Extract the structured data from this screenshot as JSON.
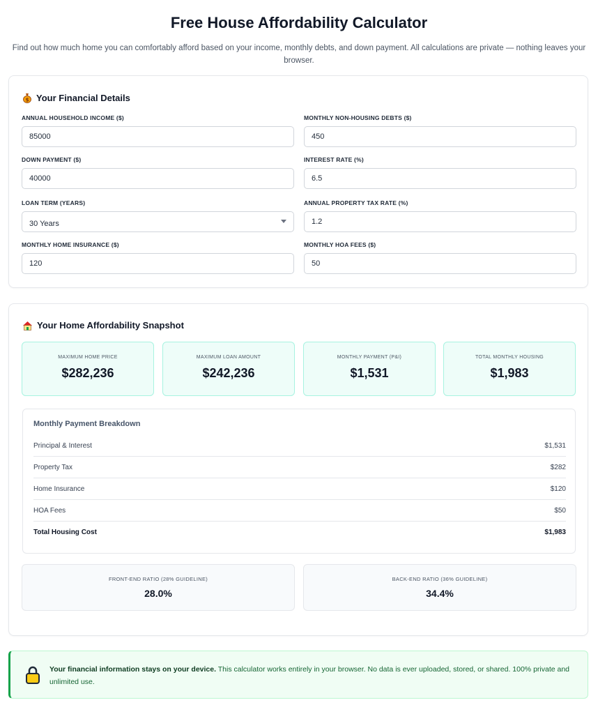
{
  "header": {
    "title": "Free House Affordability Calculator",
    "subtitle": "Find out how much home you can comfortably afford based on your income, monthly debts, and down payment. All calculations are private — nothing leaves your browser."
  },
  "details": {
    "title": "Your Financial Details",
    "icon": "money-bag-icon",
    "fields": {
      "income": {
        "label": "Annual Household Income ($)",
        "value": "85000"
      },
      "debts": {
        "label": "Monthly Non-Housing Debts ($)",
        "value": "450"
      },
      "down": {
        "label": "Down Payment ($)",
        "value": "40000"
      },
      "rate": {
        "label": "Interest Rate (%)",
        "value": "6.5"
      },
      "term": {
        "label": "Loan Term (Years)",
        "value": "30 Years"
      },
      "tax": {
        "label": "Annual Property Tax Rate (%)",
        "value": "1.2"
      },
      "insurance": {
        "label": "Monthly Home Insurance ($)",
        "value": "120"
      },
      "hoa": {
        "label": "Monthly HOA Fees ($)",
        "value": "50"
      }
    }
  },
  "snapshot": {
    "title": "Your Home Affordability Snapshot",
    "icon": "house-icon",
    "stats": [
      {
        "label": "Maximum Home Price",
        "value": "$282,236"
      },
      {
        "label": "Maximum Loan Amount",
        "value": "$242,236"
      },
      {
        "label": "Monthly Payment (P&I)",
        "value": "$1,531"
      },
      {
        "label": "Total Monthly Housing",
        "value": "$1,983"
      }
    ],
    "breakdown": {
      "title": "Monthly Payment Breakdown",
      "rows": [
        {
          "label": "Principal & Interest",
          "value": "$1,531"
        },
        {
          "label": "Property Tax",
          "value": "$282"
        },
        {
          "label": "Home Insurance",
          "value": "$120"
        },
        {
          "label": "HOA Fees",
          "value": "$50"
        },
        {
          "label": "Total Housing Cost",
          "value": "$1,983"
        }
      ]
    },
    "ratios": [
      {
        "label": "Front-End Ratio (28% Guideline)",
        "value": "28.0%"
      },
      {
        "label": "Back-End Ratio (36% Guideline)",
        "value": "34.4%"
      }
    ]
  },
  "privacy": {
    "icon": "lock-icon",
    "bold": "Your financial information stays on your device.",
    "text": " This calculator works entirely in your browser. No data is ever uploaded, stored, or shared. 100% private and unlimited use."
  },
  "colors": {
    "accent": "#10b981",
    "stat_bg": "#eefdf9",
    "privacy_bg": "#f0fdf4",
    "privacy_border": "#16a34a"
  }
}
